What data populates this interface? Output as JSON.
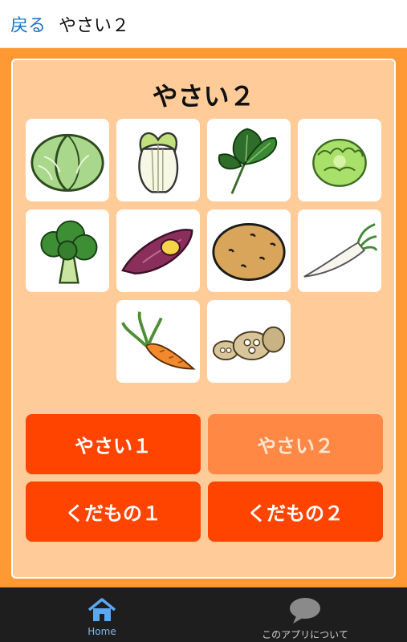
{
  "header": {
    "back_label": "戻る",
    "title": "やさい２"
  },
  "panel": {
    "title": "やさい２",
    "tiles": [
      {
        "icon": "cabbage-icon"
      },
      {
        "icon": "chinese-cabbage-icon"
      },
      {
        "icon": "spinach-icon"
      },
      {
        "icon": "lettuce-icon"
      },
      {
        "icon": "broccoli-icon"
      },
      {
        "icon": "sweet-potato-icon"
      },
      {
        "icon": "potato-icon"
      },
      {
        "icon": "daikon-radish-icon"
      },
      {
        "icon": "carrot-icon"
      },
      {
        "icon": "lotus-root-icon"
      }
    ]
  },
  "category_buttons": [
    {
      "label": "やさい１",
      "selected": false
    },
    {
      "label": "やさい２",
      "selected": true
    },
    {
      "label": "くだもの１",
      "selected": false
    },
    {
      "label": "くだもの２",
      "selected": false
    }
  ],
  "bottom_nav": {
    "home_label": "Home",
    "home_icon": "home-icon",
    "about_label": "このアプリについて",
    "about_icon": "speech-bubble-icon"
  },
  "colors": {
    "stage_background": "#ff9933",
    "panel_background": "#ffcc99",
    "button": "#ff4400",
    "button_selected": "#ff8844",
    "back_link": "#1a73c9",
    "nav_background": "#1e1e1e",
    "nav_active": "#7fb8ee"
  }
}
